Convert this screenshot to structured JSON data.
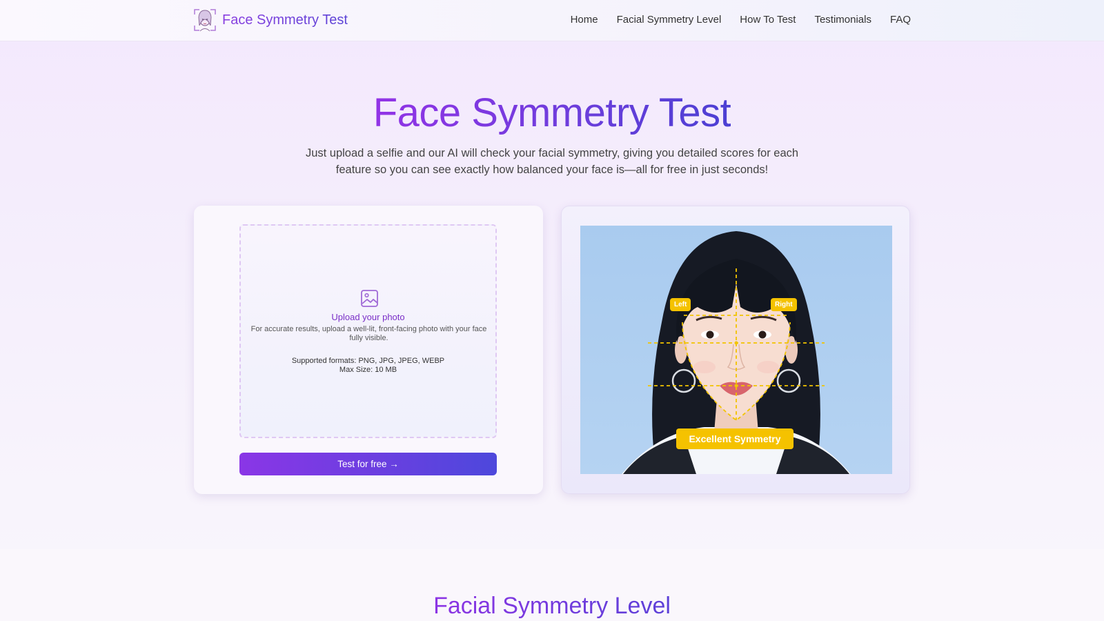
{
  "header": {
    "logo_text": "Face Symmetry Test",
    "logo_icon": "face-outline-icon",
    "nav": [
      "Home",
      "Facial Symmetry Level",
      "How To Test",
      "Testimonials",
      "FAQ"
    ]
  },
  "hero": {
    "title": "Face Symmetry Test",
    "subtitle": "Just upload a selfie and our AI will check your facial symmetry, giving you detailed scores for each feature so you can see exactly how balanced your face is—all for free in just seconds!"
  },
  "upload": {
    "icon": "image-icon",
    "title": "Upload your photo",
    "description": "For accurate results, upload a well-lit, front-facing photo with your face fully visible.",
    "formats": "Supported formats: PNG, JPG, JPEG, WEBP",
    "max_size": "Max Size: 10 MB",
    "button_label": "Test for free →"
  },
  "example": {
    "left_label": "Left",
    "right_label": "Right",
    "verdict": "Excellent Symmetry"
  },
  "section": {
    "title": "Facial Symmetry Level"
  },
  "colors": {
    "accent_purple": "#8a36e6",
    "accent_indigo": "#4d48dc",
    "badge_yellow": "#f5c200"
  }
}
